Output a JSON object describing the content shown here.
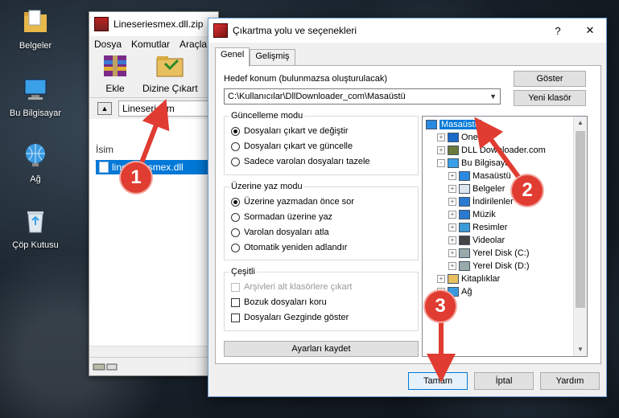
{
  "desktop": {
    "icons": [
      {
        "label": "Belgeler",
        "icon": "documents-folder-icon"
      },
      {
        "label": "Bu Bilgisayar",
        "icon": "this-pc-icon"
      },
      {
        "label": "Ağ",
        "icon": "network-icon"
      },
      {
        "label": "Çöp Kutusu",
        "icon": "recycle-bin-icon"
      }
    ]
  },
  "rar_window": {
    "title": "Lineseriesmex.dll.zip",
    "menu": [
      "Dosya",
      "Komutlar",
      "Araçla"
    ],
    "toolbar": {
      "add": "Ekle",
      "extract_to": "Dizine Çıkart"
    },
    "path": "Lineseriesm",
    "column_name": "İsim",
    "file": "lineseriesmex.dll"
  },
  "dialog": {
    "title": "Çıkartma yolu ve seçenekleri",
    "help": "?",
    "close": "✕",
    "tabs": [
      "Genel",
      "Gelişmiş"
    ],
    "destination_label": "Hedef konum (bulunmazsa oluşturulacak)",
    "destination_value": "C:\\Kullanıcılar\\DllDownloader_com\\Masaüstü",
    "show_button": "Göster",
    "new_folder_button": "Yeni klasör",
    "update_mode": {
      "title": "Güncelleme modu",
      "options": [
        "Dosyaları çıkart ve değiştir",
        "Dosyaları çıkart ve güncelle",
        "Sadece varolan dosyaları tazele"
      ],
      "selected": 0
    },
    "overwrite_mode": {
      "title": "Üzerine yaz modu",
      "options": [
        "Üzerine yazmadan önce sor",
        "Sormadan üzerine yaz",
        "Varolan dosyaları atla",
        "Otomatik yeniden adlandır"
      ],
      "selected": 0
    },
    "misc": {
      "title": "Çeşitli",
      "options": [
        "Arşivleri alt klasörlere çıkart",
        "Bozuk dosyaları koru",
        "Dosyaları Gezginde göster"
      ],
      "disabled": [
        true,
        false,
        false
      ]
    },
    "save_settings": "Ayarları kaydet",
    "tree": [
      {
        "label": "Masaüstü",
        "level": 0,
        "icon": "desktop-icon",
        "expander": "",
        "selected": true
      },
      {
        "label": "OneDr",
        "level": 1,
        "icon": "onedrive-icon",
        "expander": "+"
      },
      {
        "label": "DLL Downloader.com",
        "level": 1,
        "icon": "user-icon",
        "expander": "+"
      },
      {
        "label": "Bu Bilgisaya",
        "level": 1,
        "icon": "computer-icon",
        "expander": "-"
      },
      {
        "label": "Masaüstü",
        "level": 2,
        "icon": "desktop-icon",
        "expander": "+"
      },
      {
        "label": "Belgeler",
        "level": 2,
        "icon": "document-icon",
        "expander": "+"
      },
      {
        "label": "İndirilenler",
        "level": 2,
        "icon": "download-icon",
        "expander": "+"
      },
      {
        "label": "Müzik",
        "level": 2,
        "icon": "music-icon",
        "expander": "+"
      },
      {
        "label": "Resimler",
        "level": 2,
        "icon": "pictures-icon",
        "expander": "+"
      },
      {
        "label": "Videolar",
        "level": 2,
        "icon": "videos-icon",
        "expander": "+"
      },
      {
        "label": "Yerel Disk (C:)",
        "level": 2,
        "icon": "drive-icon",
        "expander": "+"
      },
      {
        "label": "Yerel Disk (D:)",
        "level": 2,
        "icon": "drive-icon",
        "expander": "+"
      },
      {
        "label": "Kitaplıklar",
        "level": 1,
        "icon": "libraries-icon",
        "expander": "+"
      },
      {
        "label": "Ağ",
        "level": 1,
        "icon": "network-icon",
        "expander": "+"
      }
    ],
    "ok": "Tamam",
    "cancel": "İptal",
    "help_button": "Yardım"
  },
  "annotations": [
    "1",
    "2",
    "3"
  ],
  "colors": {
    "accent": "#0078d7",
    "marker": "#e03c31"
  }
}
